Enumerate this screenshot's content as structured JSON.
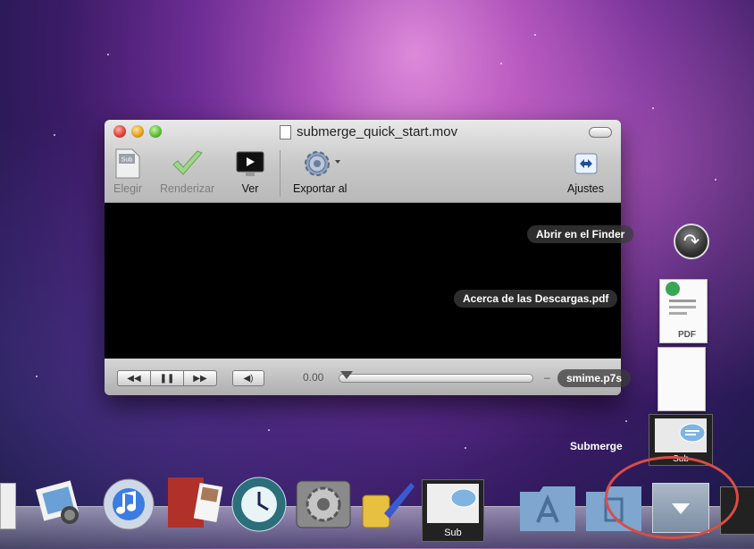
{
  "window": {
    "title": "submerge_quick_start.mov",
    "toolbar": {
      "elegir": "Elegir",
      "renderizar": "Renderizar",
      "ver": "Ver",
      "exportar": "Exportar al",
      "ajustes": "Ajustes",
      "sub_badge": "Sub"
    },
    "controls": {
      "rewind": "◀◀",
      "pause": "❚❚",
      "forward": "▶▶",
      "volume": "◀)",
      "time": "0.00",
      "end_time": "–"
    }
  },
  "downloads_stack": {
    "open_finder": "Abrir en el Finder",
    "items": [
      {
        "label": "Acerca de las Descargas.pdf",
        "badge": "PDF"
      },
      {
        "label": "smime.p7s"
      },
      {
        "label": "Submerge",
        "badge": "Sub"
      }
    ]
  },
  "dock": {
    "sub_label": "Sub"
  },
  "colors": {
    "highlight": "#d94d45",
    "video_bg": "#000000"
  }
}
